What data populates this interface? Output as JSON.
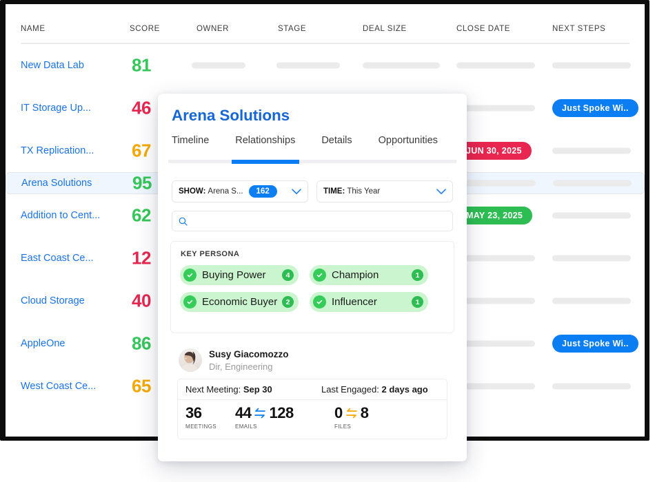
{
  "table": {
    "columns": [
      "NAME",
      "SCORE",
      "OWNER",
      "STAGE",
      "DEAL SIZE",
      "CLOSE DATE",
      "NEXT STEPS"
    ],
    "rows": [
      {
        "name": "New Data Lab",
        "score": "81",
        "score_color": "#34c759",
        "badge": null
      },
      {
        "name": "IT Storage Up...",
        "score": "46",
        "score_color": "#e8264f",
        "badge": {
          "text": "Just Spoke Wi..",
          "color": "#0b7ef4",
          "column": "next_steps"
        }
      },
      {
        "name": "TX Replication...",
        "score": "67",
        "score_color": "#f5a800",
        "badge": {
          "text": "JUN 30, 2025",
          "color": "#e8264f",
          "column": "close_date"
        }
      },
      {
        "name": "Arena Solutions",
        "score": "95",
        "score_color": "#34c759",
        "badge": null,
        "selected": true
      },
      {
        "name": "Addition to Cent...",
        "score": "62",
        "score_color": "#34c759",
        "badge": {
          "text": "MAY 23, 2025",
          "color": "#2dbd52",
          "column": "close_date"
        }
      },
      {
        "name": "East Coast Ce...",
        "score": "12",
        "score_color": "#e8264f",
        "badge": null
      },
      {
        "name": "Cloud Storage",
        "score": "40",
        "score_color": "#e8264f",
        "badge": null
      },
      {
        "name": "AppleOne",
        "score": "86",
        "score_color": "#34c759",
        "badge": {
          "text": "Just Spoke Wi..",
          "color": "#0b7ef4",
          "column": "next_steps"
        }
      },
      {
        "name": "West Coast Ce...",
        "score": "65",
        "score_color": "#f5a800",
        "badge": null
      }
    ]
  },
  "modal": {
    "title": "Arena Solutions",
    "tabs": [
      {
        "label": "Timeline",
        "active": false
      },
      {
        "label": "Relationships",
        "active": true
      },
      {
        "label": "Details",
        "active": false
      },
      {
        "label": "Opportunities",
        "active": false
      }
    ],
    "filters": {
      "show": {
        "label": "SHOW:",
        "value": "Arena S...",
        "count": "162",
        "chevron": "chevron-down"
      },
      "time": {
        "label": "TIME:",
        "value": "This Year",
        "chevron": "chevron-down"
      }
    },
    "search": {
      "placeholder": "",
      "value": "",
      "icon": "search-icon"
    },
    "persona": {
      "heading": "KEY PERSONA",
      "items": [
        {
          "label": "Buying Power",
          "count": "4"
        },
        {
          "label": "Champion",
          "count": "1"
        },
        {
          "label": "Economic Buyer",
          "count": "2"
        },
        {
          "label": "Influencer",
          "count": "1"
        }
      ]
    },
    "contact": {
      "name": "Susy Giacomozzo",
      "role": "Dir, Engineering",
      "next_meeting_label": "Next Meeting:",
      "next_meeting_value": "Sep 30",
      "last_engaged_label": "Last Engaged:",
      "last_engaged_value": "2 days ago",
      "stats": [
        {
          "key": "MEETINGS",
          "a": "36",
          "b": null,
          "arrow_color": null
        },
        {
          "key": "EMAILS",
          "a": "44",
          "b": "128",
          "arrow_color": "#0b7ef4"
        },
        {
          "key": "FILES",
          "a": "0",
          "b": "8",
          "arrow_color": "#f5a800"
        }
      ]
    }
  },
  "colors": {
    "accent": "#0b7ef4",
    "link": "#1a73e8",
    "green": "#34c759",
    "red": "#e8264f",
    "amber": "#f5a800",
    "selected_row": "#eff6fe"
  }
}
